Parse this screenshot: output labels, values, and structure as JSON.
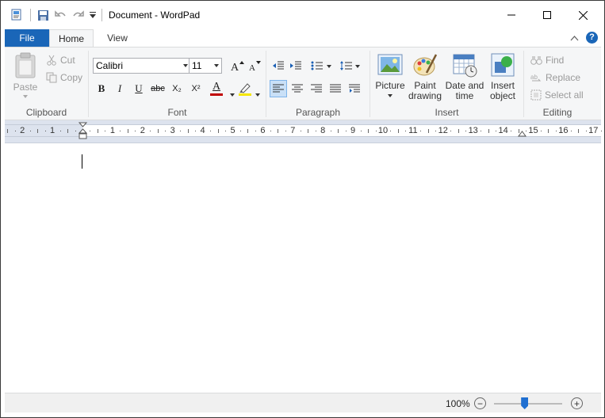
{
  "window": {
    "title": "Document - WordPad"
  },
  "tabs": {
    "file": "File",
    "home": "Home",
    "view": "View"
  },
  "clipboard": {
    "paste": "Paste",
    "cut": "Cut",
    "copy": "Copy",
    "label": "Clipboard"
  },
  "font": {
    "family": "Calibri",
    "size": "11",
    "label": "Font",
    "bold": "B",
    "italic": "I",
    "underline": "U",
    "strike": "abc",
    "subscript": "X₂",
    "superscript": "X²",
    "color_letter": "A",
    "color_accent": "#c00000",
    "highlight_accent": "#f5e600"
  },
  "paragraph": {
    "label": "Paragraph"
  },
  "insert": {
    "picture": "Picture",
    "paint_line1": "Paint",
    "paint_line2": "drawing",
    "datetime_line1": "Date and",
    "datetime_line2": "time",
    "object_line1": "Insert",
    "object_line2": "object",
    "label": "Insert"
  },
  "editing": {
    "find": "Find",
    "replace": "Replace",
    "select_all": "Select all",
    "label": "Editing"
  },
  "ruler": {
    "numbers": [
      "2",
      "1",
      "1",
      "2",
      "3",
      "4",
      "5",
      "6",
      "7",
      "8",
      "9",
      "10",
      "11",
      "12",
      "13",
      "14",
      "15",
      "16",
      "17"
    ]
  },
  "status": {
    "zoom": "100%",
    "zoom_out": "−",
    "zoom_in": "+",
    "zoom_level": 0.45
  },
  "colors": {
    "file_tab": "#1a66b8",
    "selection": "#c9e0f7",
    "slider": "#1f6fd1"
  }
}
